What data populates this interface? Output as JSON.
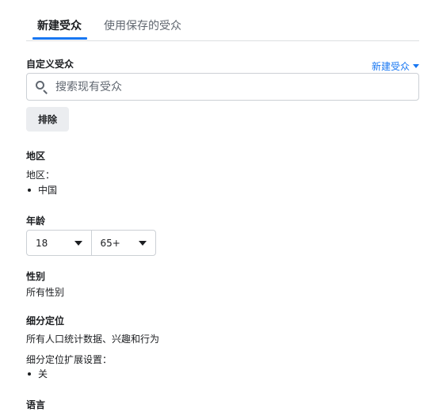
{
  "tabs": [
    {
      "label": "新建受众"
    },
    {
      "label": "使用保存的受众"
    }
  ],
  "custom_audience": {
    "heading": "自定义受众",
    "new_audience_link": "新建受众",
    "search_placeholder": "搜索现有受众",
    "exclude_label": "排除"
  },
  "location": {
    "heading": "地区",
    "sublabel": "地区：",
    "items": [
      "中国"
    ]
  },
  "age": {
    "heading": "年龄",
    "min": "18",
    "max": "65+"
  },
  "gender": {
    "heading": "性别",
    "value": "所有性别"
  },
  "detailed_targeting": {
    "heading": "细分定位",
    "value": "所有人口统计数据、兴趣和行为",
    "expansion_label": "细分定位扩展设置：",
    "expansion_items": [
      "关"
    ]
  },
  "language": {
    "heading": "语言"
  },
  "colors": {
    "accent": "#1877f2",
    "text": "#1c1e21",
    "muted": "#606770",
    "border": "#ccd0d5"
  }
}
